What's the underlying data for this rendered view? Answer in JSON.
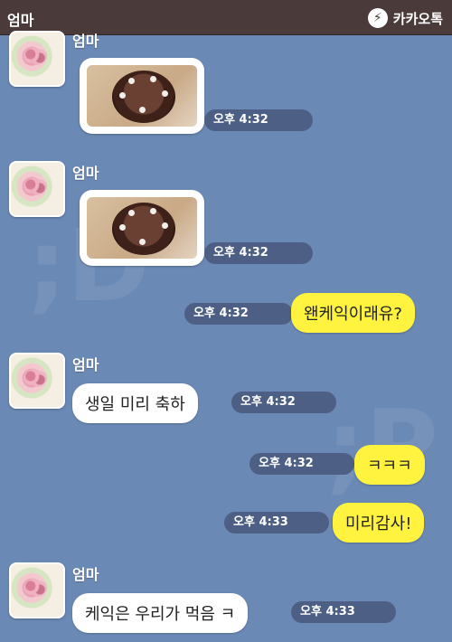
{
  "header": {
    "title": "엄마",
    "brand": "카카오톡"
  },
  "messages": [
    {
      "sender": "엄마",
      "type": "photo",
      "time": "오후 4:32"
    },
    {
      "sender": "엄마",
      "type": "photo",
      "time": "오후 4:32"
    },
    {
      "sender": "me",
      "text": "왠케익이래유?",
      "time": "오후 4:32"
    },
    {
      "sender": "엄마",
      "text": "생일 미리 축하",
      "time": "오후 4:32"
    },
    {
      "sender": "me",
      "text": "ㅋㅋㅋ",
      "time": "오후 4:32"
    },
    {
      "sender": "me",
      "text": "미리감사!",
      "time": "오후 4:33"
    },
    {
      "sender": "엄마",
      "text": "케익은 우리가 먹음 ㅋ",
      "time": "오후 4:33"
    }
  ],
  "colors": {
    "background": "#6b89b5",
    "topbar": "#4a3a3a",
    "my_bubble": "#fff33f",
    "their_bubble": "#ffffff"
  }
}
